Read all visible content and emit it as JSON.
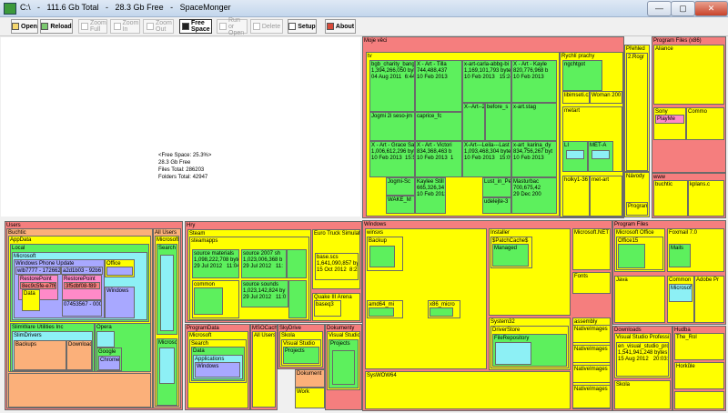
{
  "window": {
    "title": "C:\\   -   111.6 Gb Total   -   28.3 Gb Free   -   SpaceMonger",
    "minimize_glyph": "—",
    "maximize_glyph": "▢",
    "close_glyph": "✕"
  },
  "toolbar": {
    "open": "Open",
    "reload": "Reload",
    "zoom_full": "Zoom Full",
    "zoom_in": "Zoom In",
    "zoom_out": "Zoom Out",
    "free_space": "Free Space",
    "run_or_open": "Run or Open",
    "delete": "Delete",
    "setup": "Setup",
    "about": "About"
  },
  "free_space": {
    "percent": "<Free Space: 25.3%>",
    "amount": "28.3 Gb Free",
    "files": "Files Total: 286203",
    "folders": "Folders Total: 42947"
  },
  "moje": {
    "label": "Moje věci",
    "tv": "tv",
    "f1": "bgb_charity_bang\n1,394,266,050 byte\n04 Aug 2011  6:44",
    "f2": "X - Art - Tilla\n744,488,437\n10 Feb 2013",
    "f3": "x-art-carla-abbg-bi\n1,169,101,793 bytes\n10 Feb 2013   15:24",
    "f4": "X - Art - Kayle\n820,776,968 b\n10 Feb 2013",
    "f5": "Jogmi 2i seso-jm",
    "f6": "caprice_fc",
    "f7": "X--Art--2",
    "f8": "before_s",
    "f9": "x-art.stag",
    "f10": "X - Art - Grace Sa\n1,006,612,296 byte\n10 Feb 2013  15:57",
    "f11": "X - Art - Victori\n834,368,463 b\n10 Feb 2013  1",
    "f12": "X-Art---Leila---Last\n1,093,468,304 bytes\n10 Feb 2013   15:09",
    "f13": "x-art_karina_dy\n834,756,267 byt\n10 Feb 2013",
    "f14": "Jogmi-Sc",
    "f15": "Kaylee Still\n665,326,34\n10 Feb 2013",
    "f16": "WAKE_M",
    "f17": "Lust_in_Pe",
    "f18": "Masturbac\n700,675,42\n29 Dec 200",
    "f19": "udelejte-3",
    "prachy": "Rychlí prachy",
    "nightgot": "ngchtgot",
    "libimseti": "libimseti.cz",
    "woman": "Woman 200",
    "metart": "metart",
    "li": "LI",
    "metarta": "MET-A",
    "holky": "holky1-36",
    "metart2": "met-art",
    "prehled": "Přehled",
    "rogr": "2.Rogr",
    "navody": "Návody",
    "programy": "Program"
  },
  "progx86": {
    "label": "Program Files (x86)",
    "alliance": "Aliance",
    "sony": "Sony",
    "playme": "PlayMe",
    "common": "Commo",
    "www": "www",
    "buchtic": "buchtic",
    "kplans": "kplans.c"
  },
  "users": {
    "label": "Users",
    "buchtic": "Buchtic",
    "appdata": "AppData",
    "local": "Local",
    "microsoft": "Microsoft",
    "wpu": "Windows Phone Update",
    "wlb": "wlb7777 - 1726620",
    "a2d": "a2d1b03 - 92b6",
    "office": "Office",
    "restore1": "RestorePoint",
    "restore2": "RestorePoint",
    "guid1": "8ec9c5fe-e7f6",
    "guid2": "3f5dbf08-f89",
    "data": "Data",
    "size": "07453567 - 0007",
    "windows": "Windows",
    "slimware": "SlimWare Utilities Inc",
    "slimdrivers": "SlimDrivers",
    "backups": "Backups",
    "download": "Download",
    "opera": "Opera",
    "google": "Google",
    "chrome": "Chrome",
    "allusers": "All Users",
    "microsoft2": "Microsoft",
    "search": "Search",
    "microsoft3": "Microsoft"
  },
  "hry": {
    "label": "Hry",
    "steam": "Steam",
    "steamapps": "steamapps",
    "sm": "source materials\n1,098,222,708 byte\n29 Jul 2012   11:04",
    "s2007": "source 2007 sh\n1,023,006,368 b\n29 Jul 2012   11:",
    "common": "common",
    "ss": "source sounds\n1,023,142,824 by\n29 Jul 2012   11:0",
    "ets": "Euro Truck Simulat",
    "base": "base.scs\n1,641,090,857 byte\n15 Oct 2012  8:23",
    "quake": "Quake III Arena",
    "baseq3": "baseq3"
  },
  "programdata": {
    "label": "ProgramData",
    "microsoft": "Microsoft",
    "search": "Search",
    "data": "Data",
    "applications": "Applications",
    "windows": "Windows"
  },
  "msocache": {
    "label": "MSOCache",
    "allusers": "All Users"
  },
  "skydrive": {
    "label": "SkyDrive",
    "skola": "Škola",
    "visual": "Visual Studio",
    "projects": "Projects"
  },
  "dokumenty": {
    "label": "Dokumenty",
    "visual": "Visual Studio",
    "projects": "Projects",
    "dokument": "Dokument",
    "work": "Work"
  },
  "windows": {
    "label": "Windows",
    "winsxs": "winsxs",
    "backup": "Backup",
    "amd64": "amd64_mi",
    "x86": "x86_micro",
    "installer": "Installer",
    "patchcache": "$PatchCache$",
    "managed": "Managed",
    "system32": "System32",
    "driverstore": "DriverStore",
    "filerepo": "FileRepository",
    "syswow64": "SysWOW64",
    "netfx": "Microsoft.NET",
    "fonts": "Fonts",
    "assembly": "assembly",
    "nativeimages": "NativeImages",
    "nativeimages2": "NativeImages",
    "nativeimages3": "NativeImages",
    "nativeimages4": "NativeImages"
  },
  "progfiles": {
    "label": "Program Files",
    "msoffice": "Microsoft Office",
    "office15": "Office15",
    "foxmail": "Foxmail 7.0",
    "mails": "Mails",
    "java": "Java",
    "common": "Common",
    "microsoftc": "Microsoft",
    "adobe": "Adobe Pr"
  },
  "downloads": {
    "label": "Downloads",
    "vsp": "Visual Studio Professi",
    "file": "en_visual_studio_pro\n1,541,941,248 bytes\n15 Aug 2012   20:03:06",
    "skola": "Škola"
  },
  "hudba": {
    "label": "Hudba",
    "rolf": "The_Rol",
    "horkule": "Horkůle"
  }
}
